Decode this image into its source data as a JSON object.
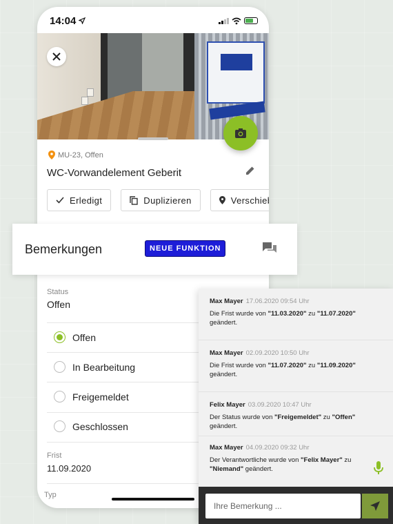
{
  "statusbar": {
    "time": "14:04"
  },
  "task": {
    "location": "MU-23, Offen",
    "title": "WC-Vorwandelement Geberit"
  },
  "actions": [
    {
      "label": "Erledigt"
    },
    {
      "label": "Duplizieren"
    },
    {
      "label": "Verschieben"
    }
  ],
  "banner": {
    "title": "Bemerkungen",
    "badge": "NEUE FUNKTION"
  },
  "status": {
    "label": "Status",
    "value": "Offen",
    "options": [
      "Offen",
      "In Bearbeitung",
      "Freigemeldet",
      "Geschlossen"
    ],
    "selected_index": 0
  },
  "frist": {
    "label": "Frist",
    "value": "11.09.2020"
  },
  "typ": {
    "label": "Typ"
  },
  "comments": [
    {
      "author": "Max Mayer",
      "datetime": "17.06.2020 09:54 Uhr",
      "pre": "Die Frist wurde von ",
      "from": "\"11.03.2020\"",
      "mid": " zu ",
      "to": "\"11.07.2020\"",
      "post": " geändert."
    },
    {
      "author": "Max Mayer",
      "datetime": "02.09.2020 10:50 Uhr",
      "pre": "Die Frist wurde von ",
      "from": "\"11.07.2020\"",
      "mid": " zu ",
      "to": "\"11.09.2020\"",
      "post": " geändert."
    },
    {
      "author": "Felix Mayer",
      "datetime": "03.09.2020 10:47 Uhr",
      "pre": "Der Status wurde von ",
      "from": "\"Freigemeldet\"",
      "mid": " zu ",
      "to": "\"Offen\"",
      "post": " geändert."
    },
    {
      "author": "Max Mayer",
      "datetime": "04.09.2020 09:32 Uhr",
      "pre": "Der Verantwortliche wurde von ",
      "from": "\"Felix Mayer\"",
      "mid": " zu ",
      "to": "\"Niemand\"",
      "post": " geändert."
    }
  ],
  "comment_input": {
    "placeholder": "Ihre Bemerkung ..."
  },
  "colors": {
    "accent_green": "#8cbf26",
    "badge_blue": "#1d1dd8",
    "location_pin": "#f29111",
    "input_bar": "#2d2d2d"
  }
}
